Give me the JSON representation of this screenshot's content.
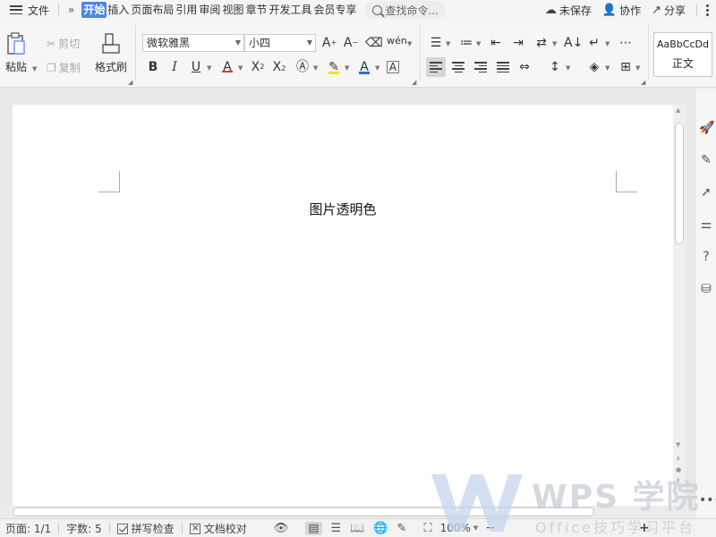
{
  "menubar": {
    "file": "文件",
    "more": "»",
    "tabs": [
      {
        "label": "开始",
        "active": true
      },
      {
        "label": "插入"
      },
      {
        "label": "页面布局"
      },
      {
        "label": "引用"
      },
      {
        "label": "审阅"
      },
      {
        "label": "视图"
      },
      {
        "label": "章节"
      },
      {
        "label": "开发工具"
      },
      {
        "label": "会员专享"
      }
    ],
    "search_placeholder": "查找命令...",
    "right": {
      "unsaved": "未保存",
      "collab": "协作",
      "share": "分享"
    }
  },
  "ribbon": {
    "paste": "粘贴",
    "cut": "剪切",
    "copy": "复制",
    "format_painter": "格式刷",
    "font_name": "微软雅黑",
    "font_size": "小四",
    "style_sample": "AaBbCcDd",
    "style_name": "正文"
  },
  "document": {
    "title": "图片透明色"
  },
  "statusbar": {
    "page": "页面: 1/1",
    "words": "字数: 5",
    "spellcheck": "拼写检查",
    "proofread": "文档校对",
    "zoom": "100%",
    "minus": "−",
    "plus": "+"
  },
  "watermark": {
    "brand": "WPS 学院",
    "slogan": "Office技巧学习平台"
  },
  "colors": {
    "accent": "#4b87e8",
    "font_color_bar": "#e53935",
    "highlight_bar": "#f2e400",
    "underline_blue": "#2f6ee8"
  }
}
